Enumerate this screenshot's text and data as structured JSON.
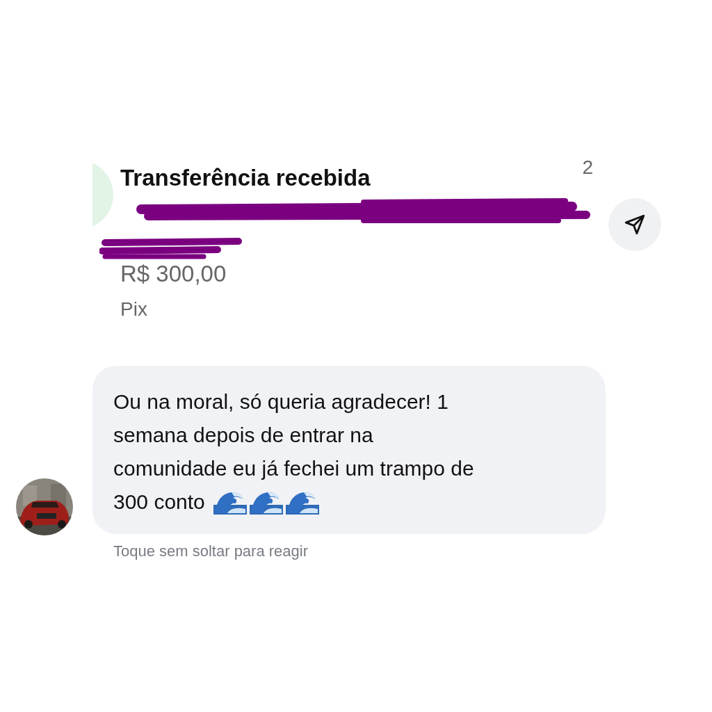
{
  "transfer": {
    "title": "Transferência recebida",
    "count": "2",
    "amount": "R$ 300,00",
    "method": "Pix"
  },
  "message": {
    "lines": [
      "Ou na moral, só queria agradecer! 1",
      "semana depois de entrar na",
      "comunidade eu já fechei um trampo de",
      "300 conto"
    ],
    "emojis": [
      {
        "kind": "wave"
      },
      {
        "kind": "wave"
      },
      {
        "kind": "wave"
      }
    ],
    "hint": "Toque sem soltar para reagir"
  }
}
